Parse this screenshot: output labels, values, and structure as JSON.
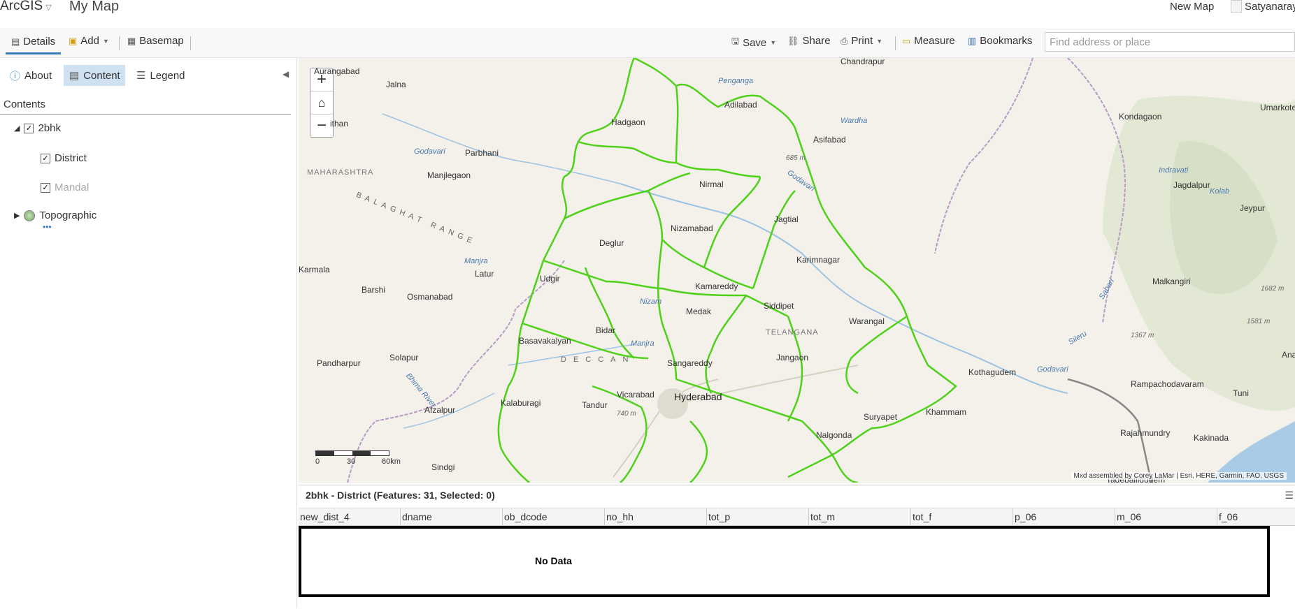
{
  "header": {
    "brand": "ArcGIS",
    "map_title": "My Map",
    "new_map": "New Map",
    "user": "Satyanaray"
  },
  "toolbar": {
    "details": "Details",
    "add": "Add",
    "basemap": "Basemap",
    "save": "Save",
    "share": "Share",
    "print": "Print",
    "measure": "Measure",
    "bookmarks": "Bookmarks",
    "search_placeholder": "Find address or place"
  },
  "panel": {
    "tabs": {
      "about": "About",
      "content": "Content",
      "legend": "Legend"
    },
    "contents_heading": "Contents",
    "layers": [
      {
        "name": "2bhk",
        "checked": true,
        "expanded": true
      },
      {
        "name": "District",
        "checked": true
      },
      {
        "name": "Mandal",
        "checked": true,
        "dimmed": true
      },
      {
        "name": "Topographic",
        "expanded": false
      }
    ],
    "more": "•••"
  },
  "map": {
    "boundary_color": "#4fd11a",
    "labels": {
      "aurangabad": "Aurangabad",
      "chandrapur": "Chandrapur",
      "jalna": "Jalna",
      "adilabad": "Adilabad",
      "umarkote": "Umarkote",
      "hadgaon": "Hadgaon",
      "penganga": "Penganga",
      "kondagaon": "Kondagaon",
      "paithan": "ithan",
      "wardha": "Wardha",
      "asifabad": "Asifabad",
      "godavari1": "Godavari",
      "parbhani": "Parbhani",
      "elev685": "685 m",
      "maharashtra": "MAHARASHTRA",
      "manjlegaon": "Manjlegaon",
      "indravati": "Indravati",
      "jagdalpur": "Jagdalpur",
      "kolab": "Kolab",
      "nirmal": "Nirmal",
      "godavari2": "Godavari",
      "balaghat": "BALAGHAT RANGE",
      "jeypur": "Jeypur",
      "jagtial": "Jagtial",
      "nizamabad": "Nizamabad",
      "degloor": "Deglur",
      "karimnagar": "Karimnagar",
      "manjra1": "Manjra",
      "latur": "Latur",
      "karmala": "Karmala",
      "udgir": "Udgir",
      "malkangiri": "Malkangiri",
      "kamareddy": "Kamareddy",
      "barshi": "Barshi",
      "sabari": "Sabari",
      "elev1682": "1682 m",
      "osmanabad": "Osmanabad",
      "nizam": "Nizam",
      "siddipet": "Siddipet",
      "medak": "Medak",
      "warangal": "Warangal",
      "elev1581": "1581 m",
      "bidar": "Bidar",
      "telangana": "TELANGANA",
      "sileru": "Sileru",
      "elev1367": "1367 m",
      "basavakalyan": "Basavakalyan",
      "manjra2": "Manjra",
      "anakap": "Anaka",
      "solapur": "Solapur",
      "jangaon": "Jangaon",
      "pandharpur": "Pandharpur",
      "deccan": "DECCAN",
      "sangareddy": "Sangareddy",
      "kothagudem": "Kothagudem",
      "godavari3": "Godavari",
      "rampachodavaram": "Rampachodavaram",
      "bhima": "Bhima River",
      "vikarabad": "Vicarabad",
      "hyderabad": "Hyderabad",
      "tuni": "Tuni",
      "afzalpur": "Afzalpur",
      "kalaburagi": "Kalaburagi",
      "tandur": "Tandur",
      "elev740": "740 m",
      "suryapet": "Suryapet",
      "khammam": "Khammam",
      "nalgonda": "Nalgonda",
      "rajahmundry": "Rajahmundry",
      "kakinada": "Kakinada",
      "sindgi": "Sindgi",
      "tadepalligudem": "Tadepalligudem"
    },
    "scale": {
      "s0": "0",
      "s30": "30",
      "s60": "60km"
    },
    "attribution": "Mxd assembled by Corey LaMar | Esri, HERE, Garmin, FAO, USGS"
  },
  "table": {
    "title": "2bhk - District (Features: 31, Selected: 0)",
    "columns": [
      "new_dist_4",
      "dname",
      "ob_dcode",
      "no_hh",
      "tot_p",
      "tot_m",
      "tot_f",
      "p_06",
      "m_06",
      "f_06"
    ],
    "empty_text": "No Data"
  }
}
